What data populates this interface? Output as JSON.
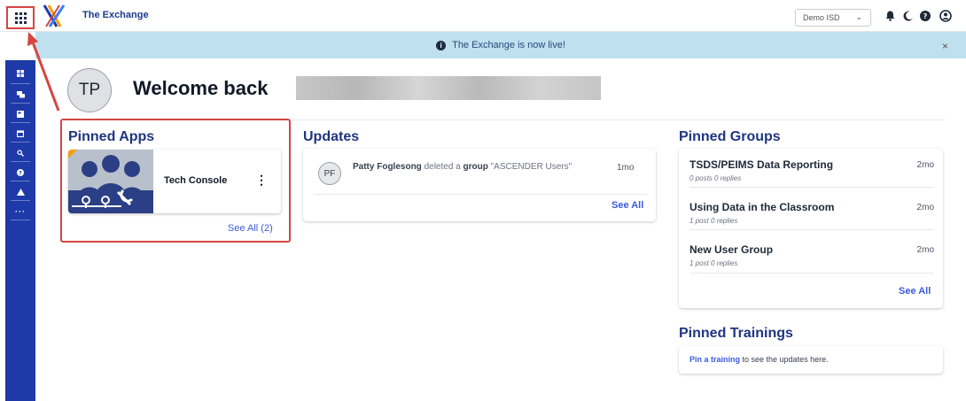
{
  "app": {
    "title": "The Exchange",
    "district": "Demo ISD"
  },
  "banner": {
    "message": "The Exchange is now live!",
    "close": "×"
  },
  "welcome": {
    "initials": "TP",
    "greeting": "Welcome back"
  },
  "pinned_apps": {
    "title": "Pinned Apps",
    "apps": [
      {
        "name": "Tech Console",
        "icon": "tech-console-icon"
      }
    ],
    "see_all": "See All (2)"
  },
  "updates": {
    "title": "Updates",
    "items": [
      {
        "initials": "PF",
        "actor": "Patty Foglesong",
        "verb": " deleted a ",
        "object": "group",
        "target": " \"ASCENDER Users\"",
        "time": "1mo"
      }
    ],
    "see_all": "See All"
  },
  "pinned_groups": {
    "title": "Pinned Groups",
    "groups": [
      {
        "name": "TSDS/PEIMS Data Reporting",
        "meta": "0 posts  0 replies",
        "time": "2mo"
      },
      {
        "name": "Using Data in the Classroom",
        "meta": "1 post  0 replies",
        "time": "2mo"
      },
      {
        "name": "New User Group",
        "meta": "1 post  0 replies",
        "time": "2mo"
      }
    ],
    "see_all": "See All"
  },
  "pinned_trainings": {
    "title": "Pinned Trainings",
    "link": "Pin a training",
    "suffix": " to see the updates here."
  },
  "icons": {
    "top": [
      "bell-icon",
      "moon-icon",
      "help-icon",
      "account-icon"
    ],
    "rail": [
      "dashboard-icon",
      "messages-icon",
      "documents-icon",
      "calendar-icon",
      "search-icon",
      "help-icon",
      "alert-icon",
      "more-icon"
    ]
  },
  "colors": {
    "rail": "#1e3aa8",
    "banner": "#bfe0ef",
    "heading": "#1f3580",
    "link": "#3b5bdb",
    "annotation": "#d64541"
  }
}
